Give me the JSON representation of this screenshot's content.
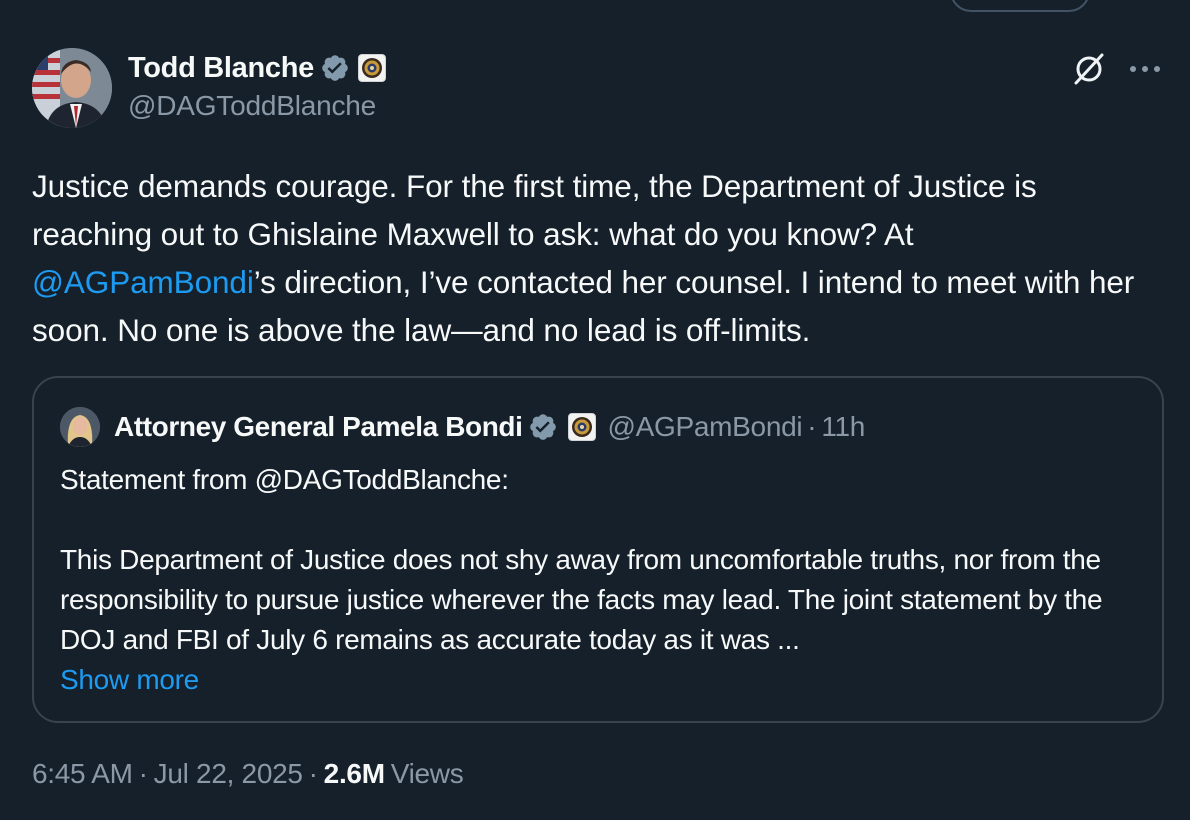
{
  "tweet": {
    "author": {
      "display_name": "Todd Blanche",
      "handle": "@DAGToddBlanche"
    },
    "text": {
      "part1": "Justice demands courage. For the first time, the Department of Justice is reaching out to Ghislaine Maxwell to ask: what do you know? At ",
      "mention": "@AGPamBondi",
      "part2": "’s direction, I’ve contacted her counsel. I intend to meet with her soon. No one is above the law—and no lead is off-limits."
    },
    "quoted": {
      "display_name": "Attorney General Pamela Bondi",
      "handle": "@AGPamBondi",
      "separator": "·",
      "time": "11h",
      "line1": "Statement from @DAGToddBlanche:",
      "body": "This Department of Justice does not shy away from uncomfortable truths, nor from the responsibility to pursue justice wherever the facts may lead.  The joint statement by the DOJ and FBI of July 6 remains as accurate today as it was ...",
      "show_more": "Show more"
    },
    "meta": {
      "time": "6:45 AM",
      "sep1": "·",
      "date": "Jul 22, 2025",
      "sep2": "·",
      "views_count": "2.6M",
      "views_label": "Views"
    }
  },
  "icons": {
    "verified": "verified-badge-icon",
    "affiliate": "doj-seal-icon",
    "grok": "grok-icon",
    "more": "more-icon"
  },
  "colors": {
    "background": "#15202b",
    "text": "#f7f9f9",
    "secondary": "#8b98a5",
    "link": "#1d9bf0",
    "border": "#38444d",
    "badge": "#829aab"
  }
}
